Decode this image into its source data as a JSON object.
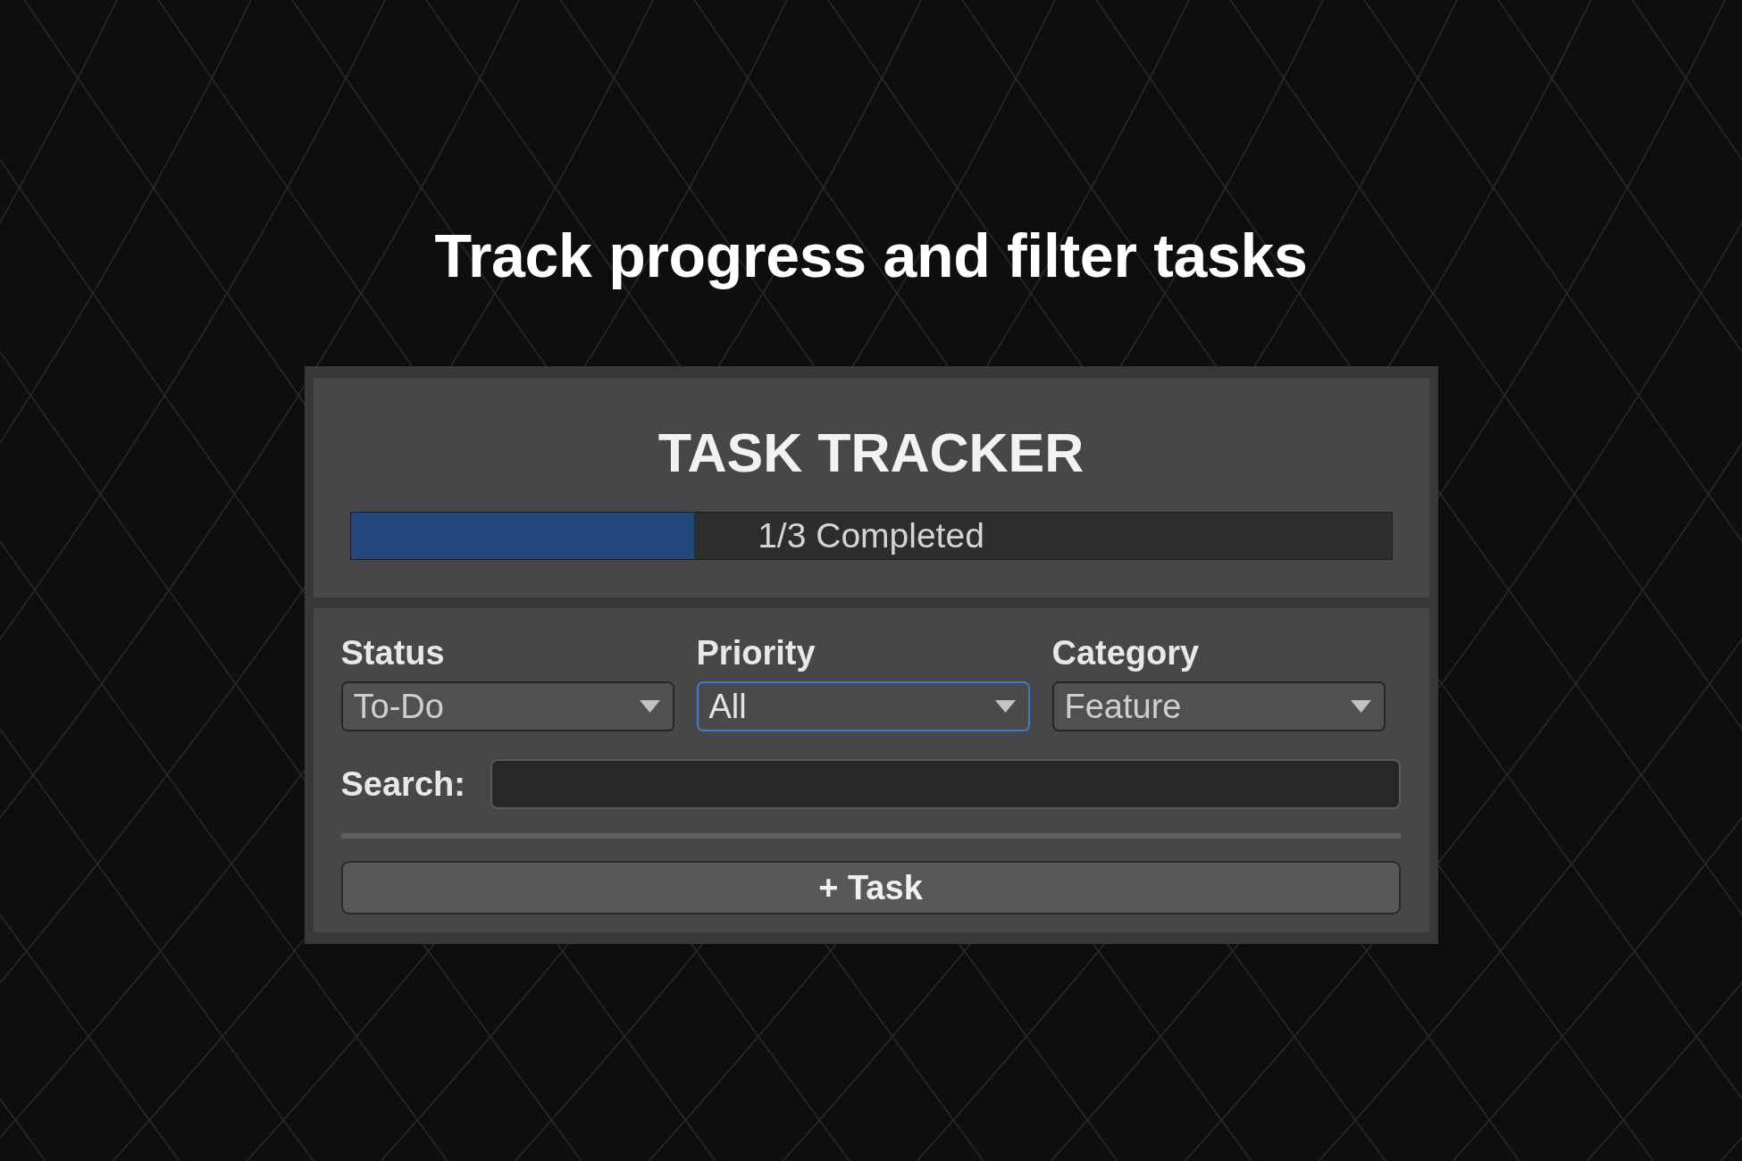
{
  "headline": "Track progress and filter tasks",
  "tracker": {
    "title": "TASK TRACKER",
    "progress": {
      "level": 0.33,
      "label": "1/3 Completed"
    },
    "filters": [
      {
        "label": "Status",
        "value": "To-Do",
        "focused": false
      },
      {
        "label": "Priority",
        "value": "All",
        "focused": true
      },
      {
        "label": "Category",
        "value": "Feature",
        "focused": false
      }
    ],
    "search": {
      "label": "Search:"
    },
    "add_button": {
      "label": "+ Task"
    }
  }
}
